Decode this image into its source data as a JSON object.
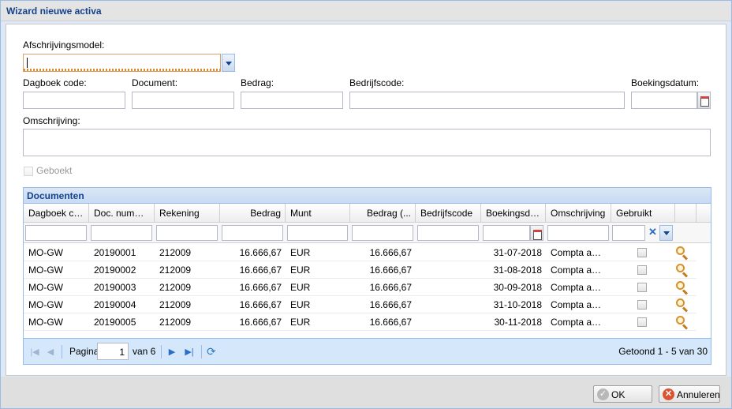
{
  "window": {
    "title": "Wizard nieuwe activa"
  },
  "form": {
    "afschrijvingsmodel_label": "Afschrijvingsmodel:",
    "afschrijvingsmodel_value": "",
    "dagboek_label": "Dagboek code:",
    "document_label": "Document:",
    "bedrag_label": "Bedrag:",
    "bedrijfscode_label": "Bedrijfscode:",
    "boekingsdatum_label": "Boekingsdatum:",
    "omschrijving_label": "Omschrijving:",
    "geboekt_label": "Geboekt",
    "geboekt_checked": false
  },
  "grid": {
    "title": "Documenten",
    "columns": [
      "Dagboek code",
      "Doc. nummer",
      "Rekening",
      "Bedrag",
      "Munt",
      "Bedrag (...",
      "Bedrijfscode",
      "Boekingsdatum",
      "Omschrijving",
      "Gebruikt"
    ],
    "rows": [
      {
        "dagboek": "MO-GW",
        "doc_nummer": "20190001",
        "rekening": "212009",
        "bedrag": "16.666,67",
        "munt": "EUR",
        "bedrag2": "16.666,67",
        "bedrijfscode": "",
        "boekingsdatum": "31-07-2018",
        "omschrijving": "Compta am...",
        "gebruikt": false,
        "action_icon": "magnifier-icon"
      },
      {
        "dagboek": "MO-GW",
        "doc_nummer": "20190002",
        "rekening": "212009",
        "bedrag": "16.666,67",
        "munt": "EUR",
        "bedrag2": "16.666,67",
        "bedrijfscode": "",
        "boekingsdatum": "31-08-2018",
        "omschrijving": "Compta am...",
        "gebruikt": false,
        "action_icon": "magnifier-icon"
      },
      {
        "dagboek": "MO-GW",
        "doc_nummer": "20190003",
        "rekening": "212009",
        "bedrag": "16.666,67",
        "munt": "EUR",
        "bedrag2": "16.666,67",
        "bedrijfscode": "",
        "boekingsdatum": "30-09-2018",
        "omschrijving": "Compta am...",
        "gebruikt": false,
        "action_icon": "magnifier-icon"
      },
      {
        "dagboek": "MO-GW",
        "doc_nummer": "20190004",
        "rekening": "212009",
        "bedrag": "16.666,67",
        "munt": "EUR",
        "bedrag2": "16.666,67",
        "bedrijfscode": "",
        "boekingsdatum": "31-10-2018",
        "omschrijving": "Compta am...",
        "gebruikt": false,
        "action_icon": "magnifier-icon"
      },
      {
        "dagboek": "MO-GW",
        "doc_nummer": "20190005",
        "rekening": "212009",
        "bedrag": "16.666,67",
        "munt": "EUR",
        "bedrag2": "16.666,67",
        "bedrijfscode": "",
        "boekingsdatum": "30-11-2018",
        "omschrijving": "Compta am...",
        "gebruikt": false,
        "action_icon": "magnifier-icon"
      }
    ]
  },
  "pager": {
    "page_label": "Pagina",
    "page_value": "1",
    "of_label": "van 6",
    "summary": "Getoond 1 - 5 van 30"
  },
  "buttons": {
    "ok": "OK",
    "cancel": "Annuleren"
  }
}
